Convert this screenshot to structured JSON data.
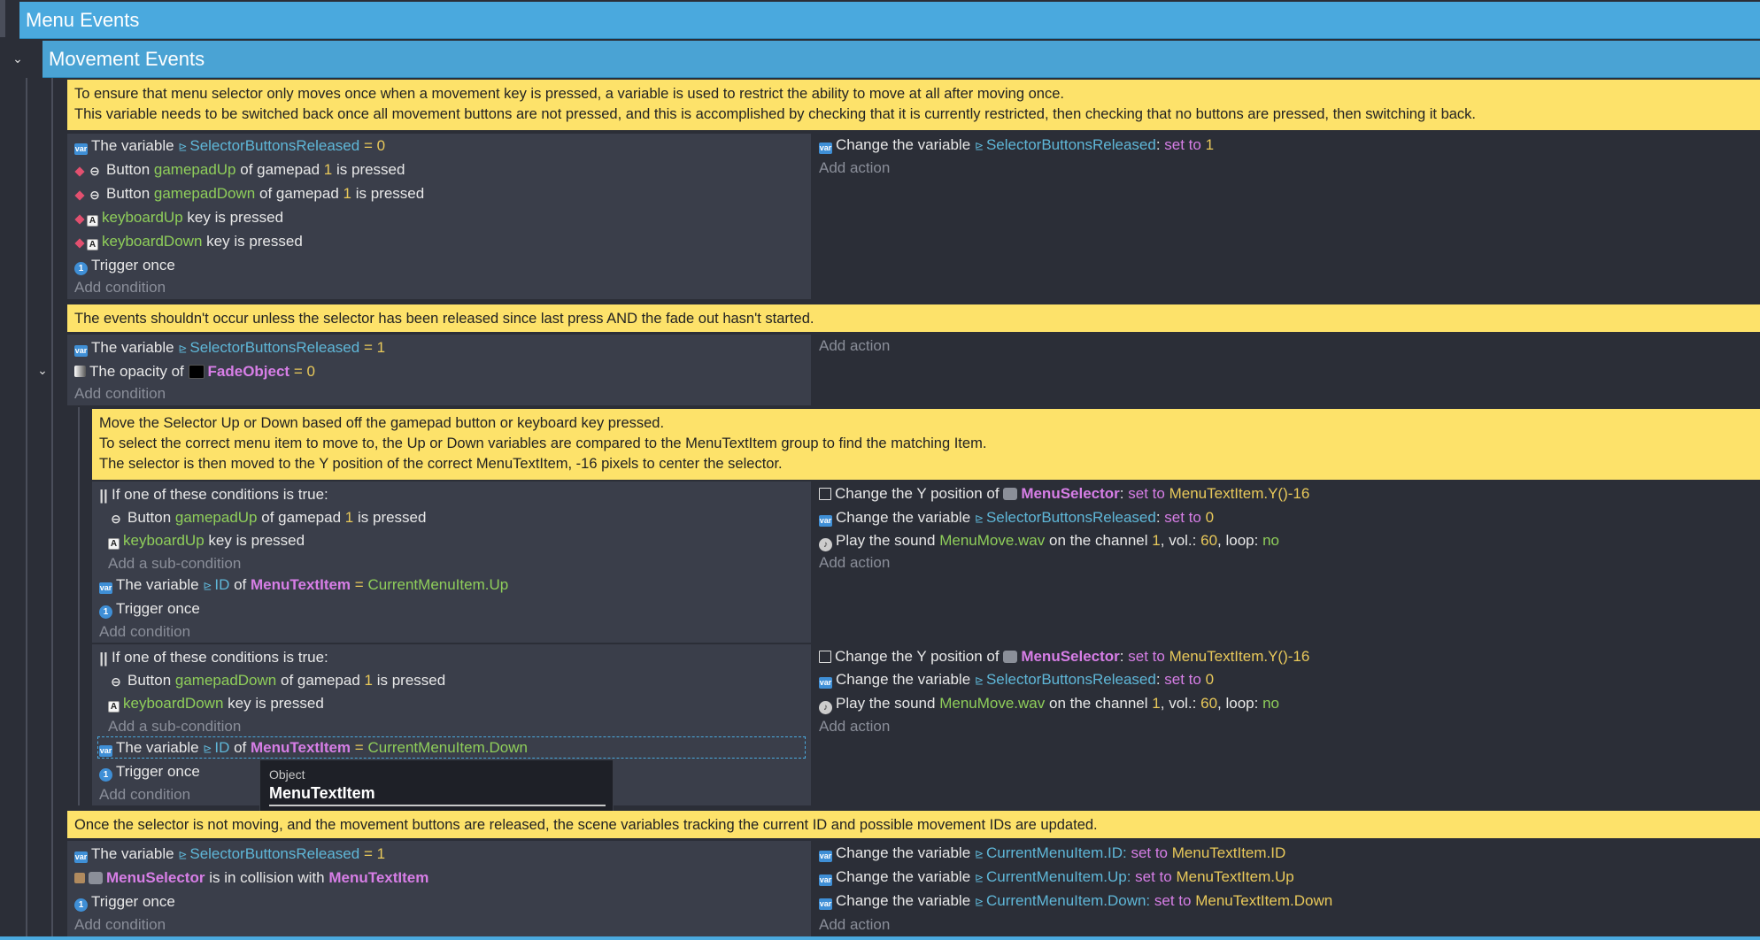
{
  "groups": {
    "menu_events": "Menu Events",
    "movement_events": "Movement Events"
  },
  "comments": {
    "c1": [
      "To ensure that menu selector only moves once when a movement key is pressed, a variable is used to restrict the ability to move at all after moving once.",
      "This variable needs to be switched back once all movement buttons are not pressed, and this is accomplished by checking that it is currently restricted, then checking that no buttons are pressed, then switching it back."
    ],
    "c2": [
      "The events shouldn't occur unless the selector has been released since last press AND the fade out hasn't started."
    ],
    "c3": [
      "Move the Selector Up or Down based off the gamepad button or keyboard key pressed.",
      "To select the correct menu item to move to, the Up or Down variables are compared to the MenuTextItem group to find the matching Item.",
      "The selector is then moved to the Y position of the correct MenuTextItem, -16 pixels to center the selector."
    ],
    "c4": [
      "Once the selector is not moving, and the movement buttons are released, the scene variables tracking the current ID and possible movement IDs are updated."
    ]
  },
  "text": {
    "the_variable": "The variable",
    "button": "Button",
    "of_gamepad": "of gamepad",
    "is_pressed": "is pressed",
    "key_is_pressed": "key is pressed",
    "trigger_once": "Trigger once",
    "add_condition": "Add condition",
    "add_action": "Add action",
    "add_sub_condition": "Add a sub-condition",
    "change_the_variable": "Change the variable",
    "set_to": "set to",
    "the_opacity_of": "The opacity of",
    "if_one_true": "If one of these conditions is true:",
    "change_y_of": "Change the Y position of",
    "play_sound": "Play the sound",
    "on_channel": "on the channel",
    "vol": ", vol.:",
    "loop": ", loop:",
    "is_in_collision": "is in collision with",
    "eq": "=",
    "of": "of",
    "colon": ":"
  },
  "names": {
    "selector_released": "SelectorButtonsReleased",
    "gamepad_up": "gamepadUp",
    "gamepad_down": "gamepadDown",
    "keyboard_up": "keyboardUp",
    "keyboard_down": "keyboardDown",
    "fade_object": "FadeObject",
    "menu_selector": "MenuSelector",
    "menu_text_item": "MenuTextItem",
    "menu_y": "MenuTextItem.Y()-16",
    "sound_file": "MenuMove.wav",
    "id": "ID",
    "current_up": "CurrentMenuItem.Up",
    "current_down": "CurrentMenuItem.Down",
    "current_id_var": "CurrentMenuItem.ID:",
    "current_up_var": "CurrentMenuItem.Up:",
    "current_down_var": "CurrentMenuItem.Down:",
    "mti_id": "MenuTextItem.ID",
    "mti_up": "MenuTextItem.Up",
    "mti_down": "MenuTextItem.Down"
  },
  "values": {
    "zero": "0",
    "one": "1",
    "sixty": "60",
    "no": "no"
  },
  "tooltip": {
    "label": "Object",
    "value": "MenuTextItem"
  }
}
